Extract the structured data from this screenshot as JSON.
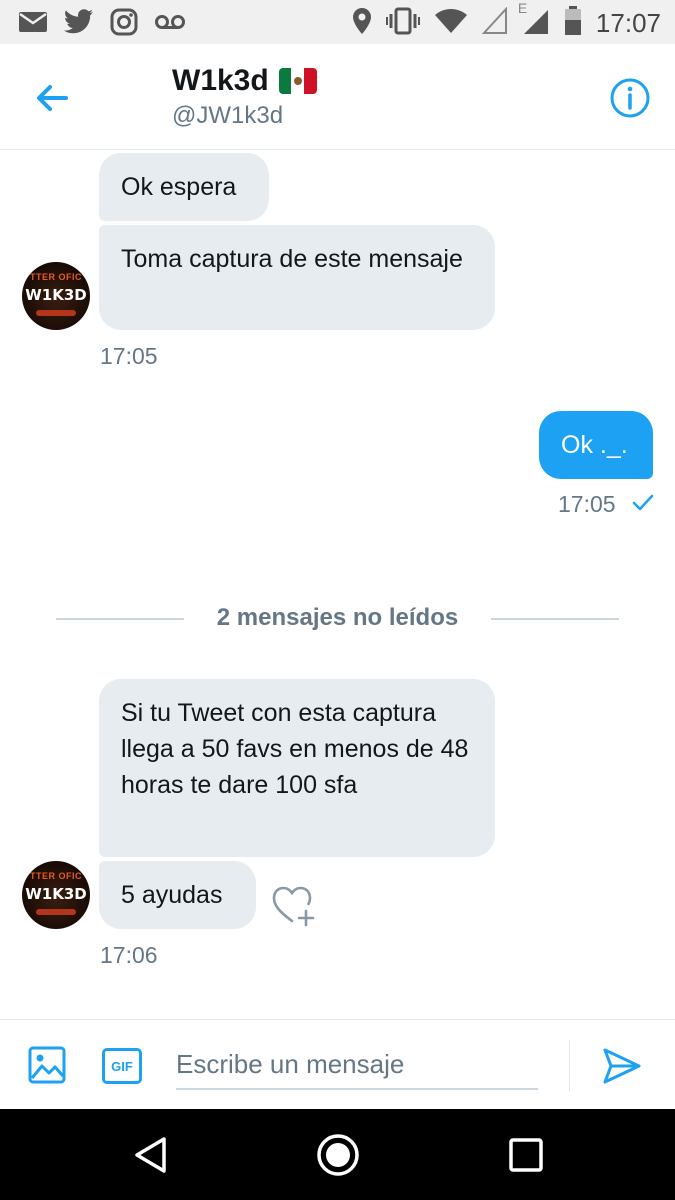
{
  "status_bar": {
    "time": "17:07",
    "network_label": "E",
    "left_icons": [
      "mail-icon",
      "twitter-icon",
      "instagram-icon",
      "voicemail-icon"
    ],
    "right_icons": [
      "location-icon",
      "vibrate-icon",
      "wifi-icon",
      "signal-empty-icon",
      "signal-icon",
      "battery-icon"
    ]
  },
  "header": {
    "title": "W1k3d",
    "handle": "@JW1k3d",
    "flag": "mexico-flag",
    "accent_color": "#1da1f2"
  },
  "avatar": {
    "top_text": "TTER OFIC",
    "name_text": "W1K3D"
  },
  "messages": {
    "m1": "Ok espera",
    "m2": "Toma captura de este mensaje",
    "ts1": "17:05",
    "m3": "Ok ._.",
    "ts2": "17:05",
    "m4": "Si tu Tweet con esta captura llega a 50 favs en menos de 48 horas te dare 100 sfa",
    "m5": "5 ayudas",
    "ts3": "17:06"
  },
  "divider": {
    "label": "2 mensajes no leídos"
  },
  "composer": {
    "placeholder": "Escribe un mensaje",
    "value": "",
    "gif_label": "GIF"
  }
}
